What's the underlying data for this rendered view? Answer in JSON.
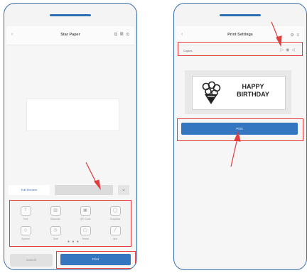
{
  "left_screen": {
    "title": "Star Paper",
    "nav_back_icon": "chevron-left-icon",
    "nav_label": "",
    "nav_icons": [
      "share-icon",
      "grid-icon",
      "gear-icon"
    ],
    "tabs": [
      {
        "label": "Edit Element"
      },
      {
        "label": ""
      },
      {
        "icon": "chevron-down-icon"
      }
    ],
    "tools": [
      {
        "label": "Text",
        "icon": "text-icon"
      },
      {
        "label": "Barcode",
        "icon": "barcode-icon"
      },
      {
        "label": "QR Code",
        "icon": "qr-icon"
      },
      {
        "label": "Graphics",
        "icon": "shape-icon"
      },
      {
        "label": "Symbol",
        "icon": "symbol-icon"
      },
      {
        "label": "Time",
        "icon": "clock-icon"
      },
      {
        "label": "Frame",
        "icon": "frame-icon"
      },
      {
        "label": "Line",
        "icon": "line-icon"
      }
    ],
    "pager_dots": "● ● ●",
    "cancel_label": "Cancel",
    "print_label": "Print"
  },
  "right_screen": {
    "title": "Print Settings",
    "setting_label": "Copies",
    "setting_controls": [
      "minus-icon",
      "copy-count-icon",
      "plus-icon"
    ],
    "preview_text_line1": "HAPPY",
    "preview_text_line2": "BIRTHDAY",
    "print_label": "Print"
  },
  "colors": {
    "frame": "#3b6fa8",
    "highlight": "#e23c3c",
    "primary_button": "#3476bf"
  }
}
